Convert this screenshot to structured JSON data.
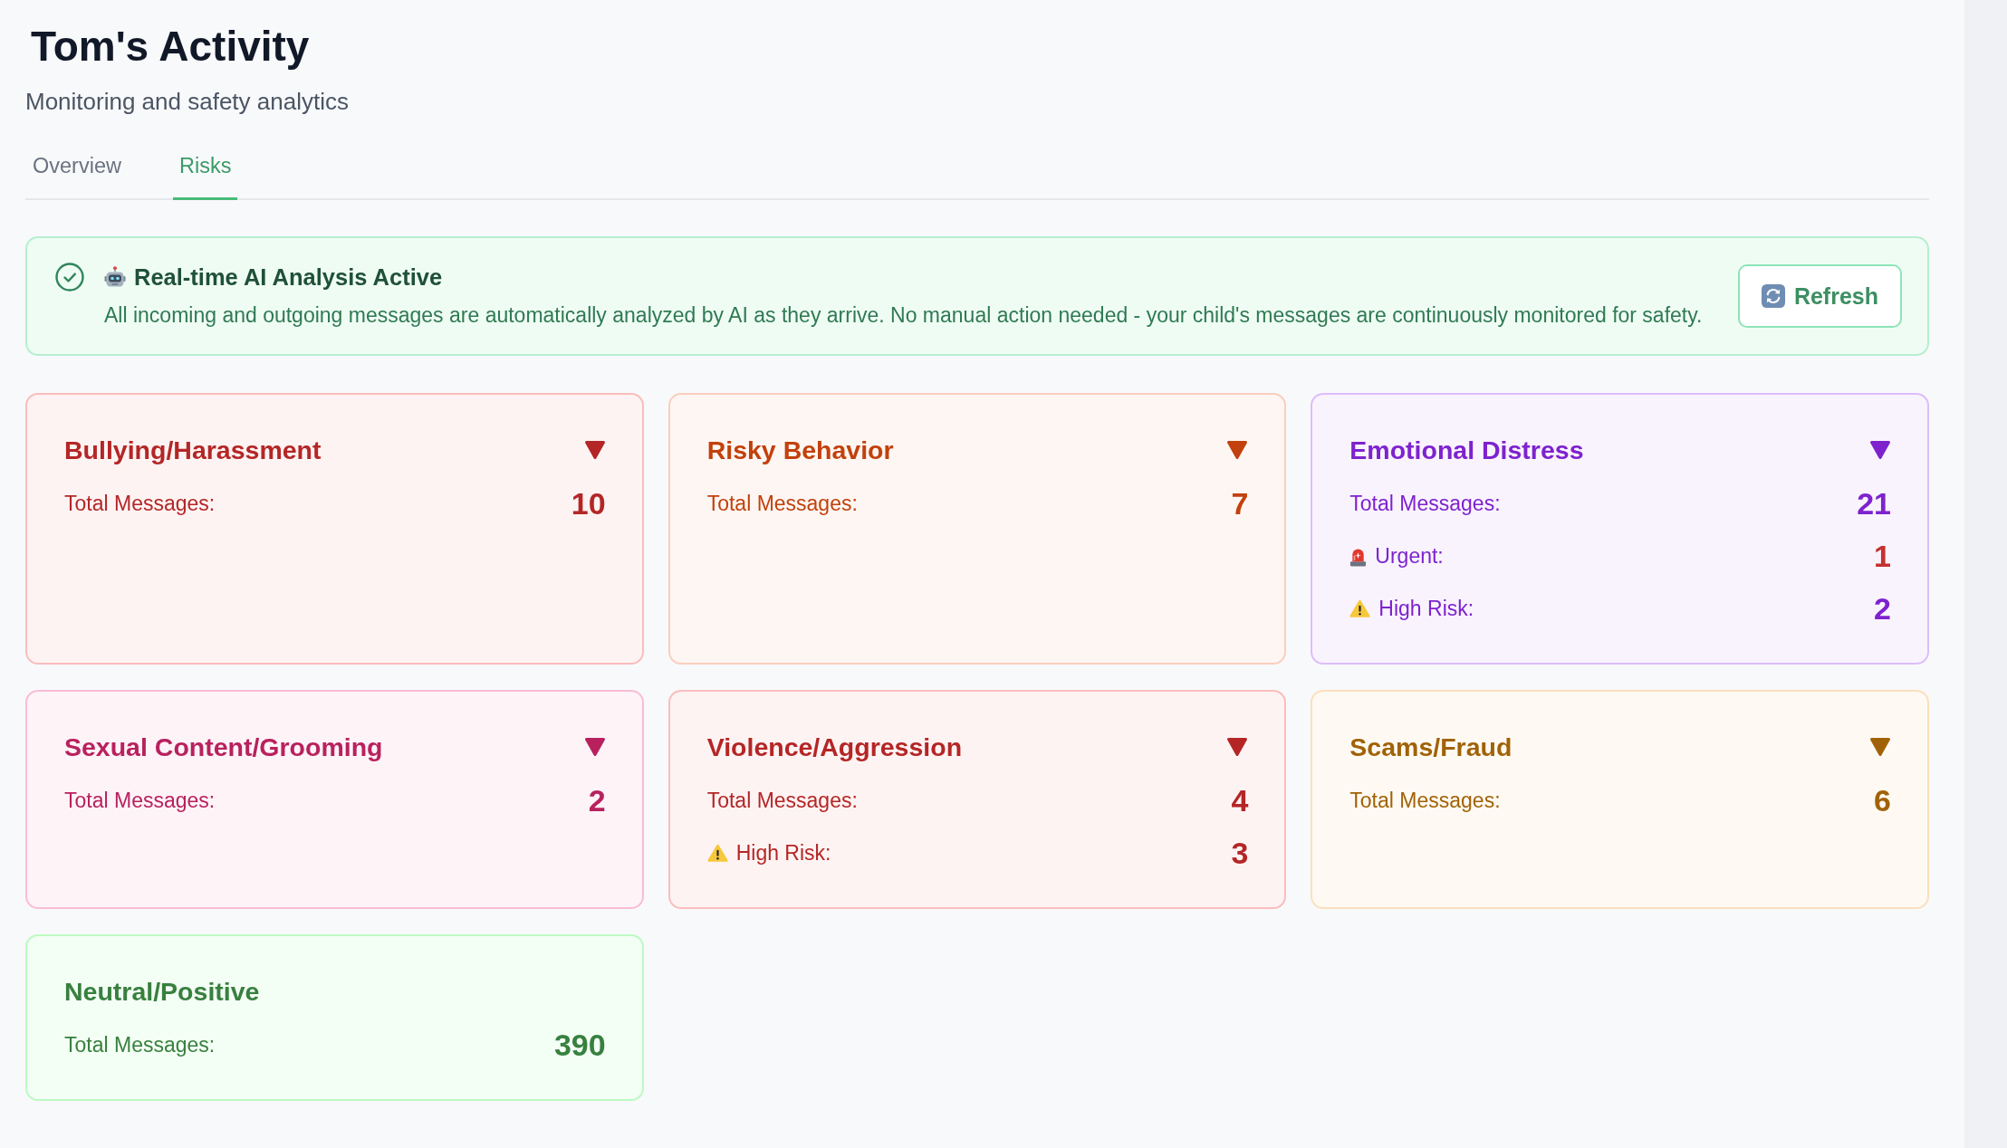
{
  "page": {
    "title": "Tom's Activity",
    "subtitle": "Monitoring and safety analytics"
  },
  "tabs": [
    {
      "label": "Overview",
      "selected": false
    },
    {
      "label": "Risks",
      "selected": true
    }
  ],
  "analysis_banner": {
    "title": "Real-time AI Analysis Active",
    "message": "All incoming and outgoing messages are automatically analyzed by AI as they arrive. No manual action needed - your child's messages are continuously monitored for safety.",
    "button": "Refresh"
  },
  "categories": [
    {
      "title": "Bullying/Harassment",
      "color": "#b42626",
      "expandable": true,
      "stats": [
        {
          "kind": "total",
          "label": "Total Messages:",
          "value": "10"
        }
      ]
    },
    {
      "title": "Risky Behavior",
      "color": "#c2410c",
      "expandable": true,
      "stats": [
        {
          "kind": "total",
          "label": "Total Messages:",
          "value": "7"
        }
      ]
    },
    {
      "title": "Emotional Distress",
      "color": "#7e22ce",
      "expandable": true,
      "stats": [
        {
          "kind": "total",
          "label": "Total Messages:",
          "value": "21"
        },
        {
          "kind": "urgent",
          "label": "Urgent:",
          "value": "1"
        },
        {
          "kind": "high_risk",
          "label": "High Risk:",
          "value": "2"
        }
      ]
    },
    {
      "title": "Sexual Content/Grooming",
      "color": "#b8215e",
      "expandable": true,
      "stats": [
        {
          "kind": "total",
          "label": "Total Messages:",
          "value": "2"
        }
      ]
    },
    {
      "title": "Violence/Aggression",
      "color": "#b42626",
      "expandable": true,
      "stats": [
        {
          "kind": "total",
          "label": "Total Messages:",
          "value": "4"
        },
        {
          "kind": "high_risk",
          "label": "High Risk:",
          "value": "3"
        }
      ]
    },
    {
      "title": "Scams/Fraud",
      "color": "#a16207",
      "expandable": true,
      "stats": [
        {
          "kind": "total",
          "label": "Total Messages:",
          "value": "6"
        }
      ]
    },
    {
      "title": "Neutral/Positive",
      "color": "#38803f",
      "expandable": false,
      "stats": [
        {
          "kind": "total",
          "label": "Total Messages:",
          "value": "390"
        }
      ]
    }
  ]
}
